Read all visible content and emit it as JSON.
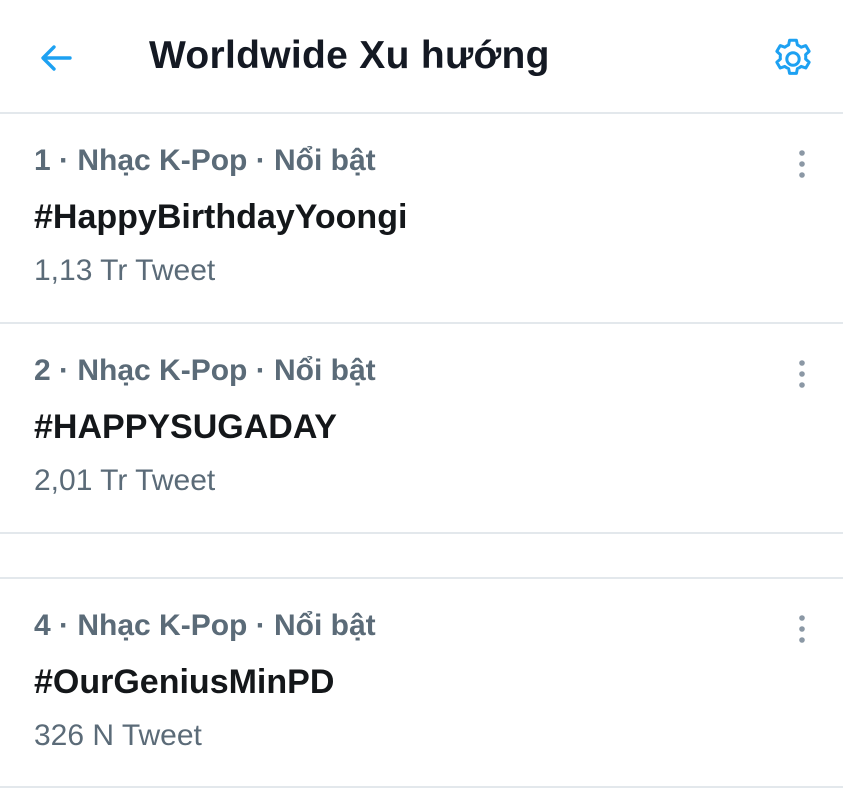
{
  "header": {
    "back_icon": "arrow-left-icon",
    "title": "Worldwide Xu hướng",
    "settings_icon": "gear-icon"
  },
  "colors": {
    "accent": "#1da1f2",
    "secondary_text": "#5b6b78",
    "primary_text": "#14171a",
    "divider": "#e3e8ec"
  },
  "trends": [
    {
      "context": "1 · Nhạc K-Pop · Nổi bật",
      "name": "#HappyBirthdayYoongi",
      "count": "1,13 Tr Tweet",
      "more_icon": "more-vertical-icon"
    },
    {
      "context": "2 · Nhạc K-Pop · Nổi bật",
      "name": "#HAPPYSUGADAY",
      "count": "2,01 Tr Tweet",
      "more_icon": "more-vertical-icon"
    },
    {
      "context": "4 · Nhạc K-Pop · Nổi bật",
      "name": "#OurGeniusMinPD",
      "count": "326 N Tweet",
      "more_icon": "more-vertical-icon"
    }
  ]
}
